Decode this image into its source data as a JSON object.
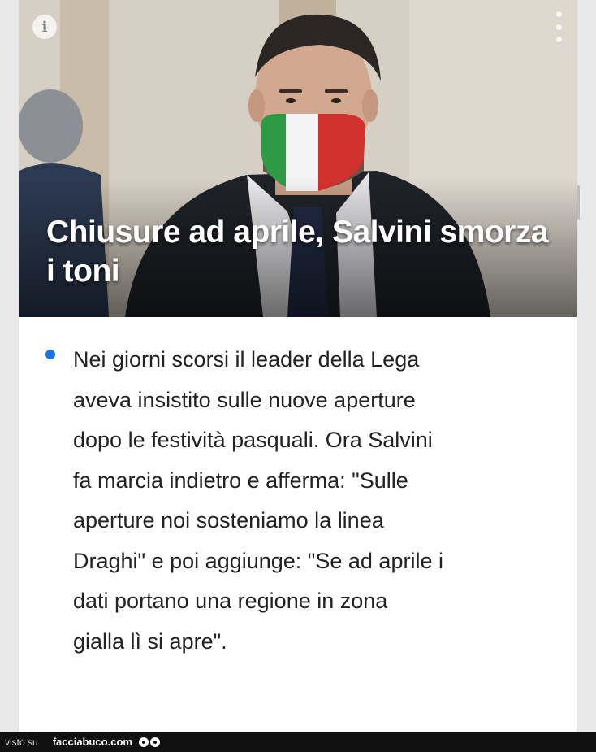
{
  "article": {
    "headline": "Chiusure ad aprile, Salvini smorza i toni",
    "summary": "Nei giorni scorsi il leader della Lega\naveva insistito sulle nuove aperture\ndopo le festività pasquali. Ora Salvini\nfa marcia indietro e afferma: \"Sulle\naperture noi sosteniamo la linea\nDraghi\" e poi aggiunge: \"Se ad aprile i\ndati portano una regione in zona\ngialla lì si apre\"."
  },
  "icons": {
    "info": "info-icon",
    "more": "more-vertical-icon",
    "bullet": "bullet-dot"
  },
  "colors": {
    "bullet": "#1a73e8",
    "headline": "#ffffff",
    "body_text": "#222222"
  },
  "footer": {
    "prefix": "visto su",
    "site": "facciabuco.com"
  }
}
